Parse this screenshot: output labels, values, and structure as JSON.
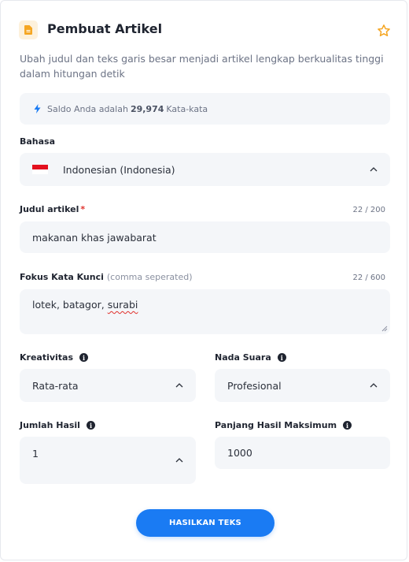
{
  "header": {
    "title": "Pembuat Artikel",
    "description": "Ubah judul dan teks garis besar menjadi artikel lengkap berkualitas tinggi dalam hitungan detik",
    "icon": "document-icon",
    "favorite_icon": "star-outline-icon"
  },
  "balance": {
    "prefix": "Saldo Anda adalah",
    "value": "29,974",
    "suffix": "Kata-kata",
    "icon": "lightning-icon"
  },
  "language": {
    "label": "Bahasa",
    "value": "Indonesian (Indonesia)",
    "flag": "indonesia-flag"
  },
  "article_title": {
    "label": "Judul artikel",
    "required_mark": "*",
    "counter": "22 / 200",
    "value": "makanan khas jawabarat"
  },
  "keywords": {
    "label": "Fokus Kata Kunci",
    "hint": "(comma seperated)",
    "counter": "22 / 600",
    "value_plain": "lotek, batagor, ",
    "value_misspelled": "surabi"
  },
  "creativity": {
    "label": "Kreativitas",
    "value": "Rata-rata"
  },
  "tone": {
    "label": "Nada Suara",
    "value": "Profesional"
  },
  "result_count": {
    "label": "Jumlah Hasil",
    "value": "1"
  },
  "max_length": {
    "label": "Panjang Hasil Maksimum",
    "value": "1000"
  },
  "submit": {
    "label": "HASILKAN TEKS"
  },
  "colors": {
    "accent": "#1a7bf3",
    "star": "#f5a623",
    "field_bg": "#f4f6f9",
    "required": "#e0322d"
  }
}
